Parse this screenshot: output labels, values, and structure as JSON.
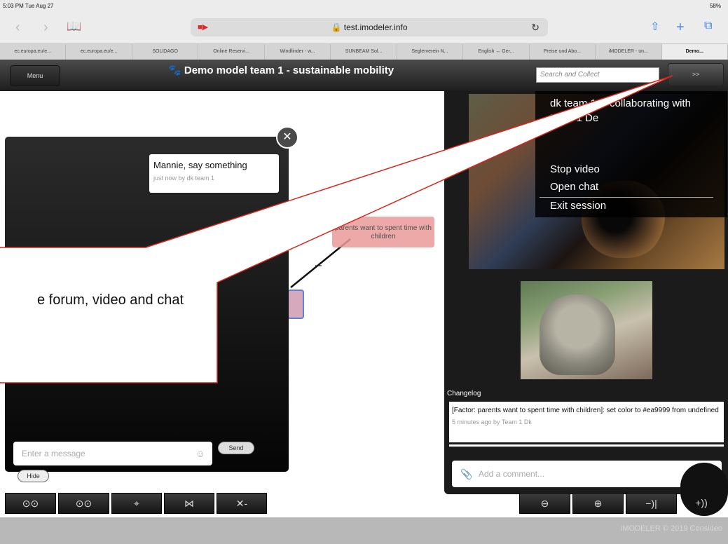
{
  "status_bar": {
    "time": "5:03 PM  Tue Aug 27",
    "battery": "58%"
  },
  "browser": {
    "url": "test.imodeler.info",
    "tabs": [
      "ec.europa.eu/e...",
      "ec.europa.eu/e...",
      "SOLIDAGO",
      "Online Reservi...",
      "Windfinder - w...",
      "SUNBEAM Sol...",
      "Seglerverein N...",
      "English ↔ Ger...",
      "Preise und Abo...",
      "iMODELER - un...",
      "Demo..."
    ]
  },
  "app_header": {
    "menu_label": "Menu",
    "title": "Demo model team 1 - sustainable mobility",
    "search_placeholder": "Search and Collect",
    "collapse_label": ">>"
  },
  "canvas": {
    "factor_label": "parents want to spent time with children",
    "factor_color": "#ea9999",
    "edge_label": "–"
  },
  "chat": {
    "message": "Mannie, say something",
    "meta": "just now by dk team 1",
    "input_placeholder": "Enter a message",
    "send_label": "Send",
    "hide_label": "Hide"
  },
  "video_menu": {
    "title": "dk team 1 is collaborating with team 1 De",
    "items": [
      "Stop video",
      "Open chat",
      "Exit session"
    ]
  },
  "changelog": {
    "label": "Changelog",
    "entry": "[Factor: parents want to spent time with children]: set color to #ea9999 from undefined",
    "meta": "5 minutes ago by Team 1 Dk",
    "comment_placeholder": "Add a comment..."
  },
  "toolbar_left": [
    "⊙⊙",
    "⊙⊙",
    "⌖",
    "⋈",
    "✕-"
  ],
  "toolbar_right": [
    "⊖",
    "⊕",
    "−)|",
    "+))"
  ],
  "callout": {
    "text": "e forum, video and chat",
    "border_color": "#d9261c"
  },
  "footer": {
    "copyright": "iMODELER © 2019 Consideo"
  }
}
